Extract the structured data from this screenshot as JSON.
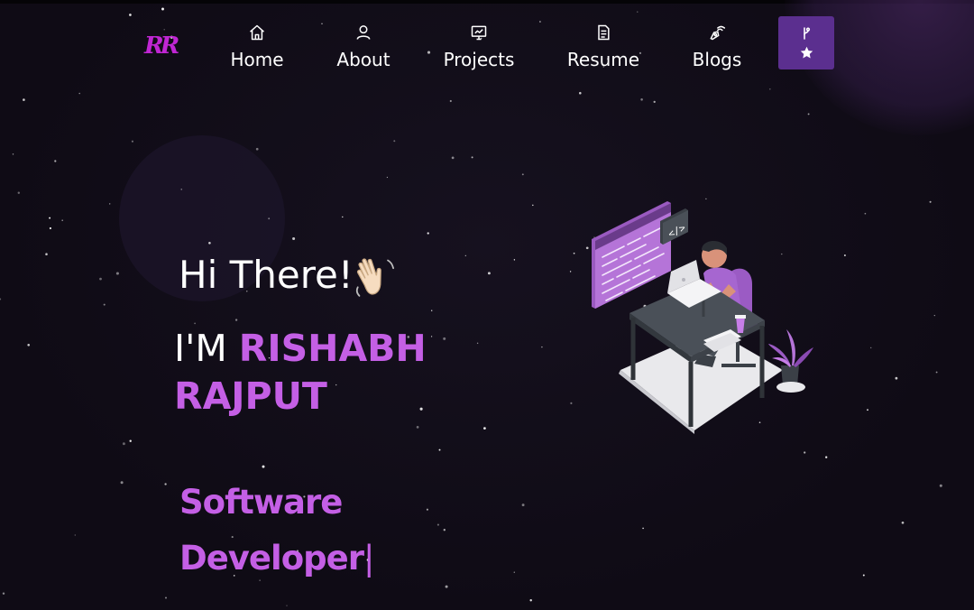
{
  "logo": {
    "text": "RR"
  },
  "nav": {
    "items": [
      {
        "label": "Home",
        "icon": "home-icon"
      },
      {
        "label": "About",
        "icon": "user-icon"
      },
      {
        "label": "Projects",
        "icon": "presentation-icon"
      },
      {
        "label": "Resume",
        "icon": "document-icon"
      },
      {
        "label": "Blogs",
        "icon": "pen-nib-icon"
      }
    ],
    "fork_button": {
      "icons": [
        "git-fork-icon",
        "star-icon"
      ]
    }
  },
  "hero": {
    "greeting": "Hi There!",
    "greeting_emoji": "waving-hand-icon",
    "intro_prefix": "I'M ",
    "name": "RISHABH RAJPUT",
    "role": "Software Developer",
    "cursor": "|"
  },
  "colors": {
    "background": "#110d18",
    "accent": "#c45fe5",
    "logo": "#c026d3",
    "button": "#5b2f8f"
  }
}
